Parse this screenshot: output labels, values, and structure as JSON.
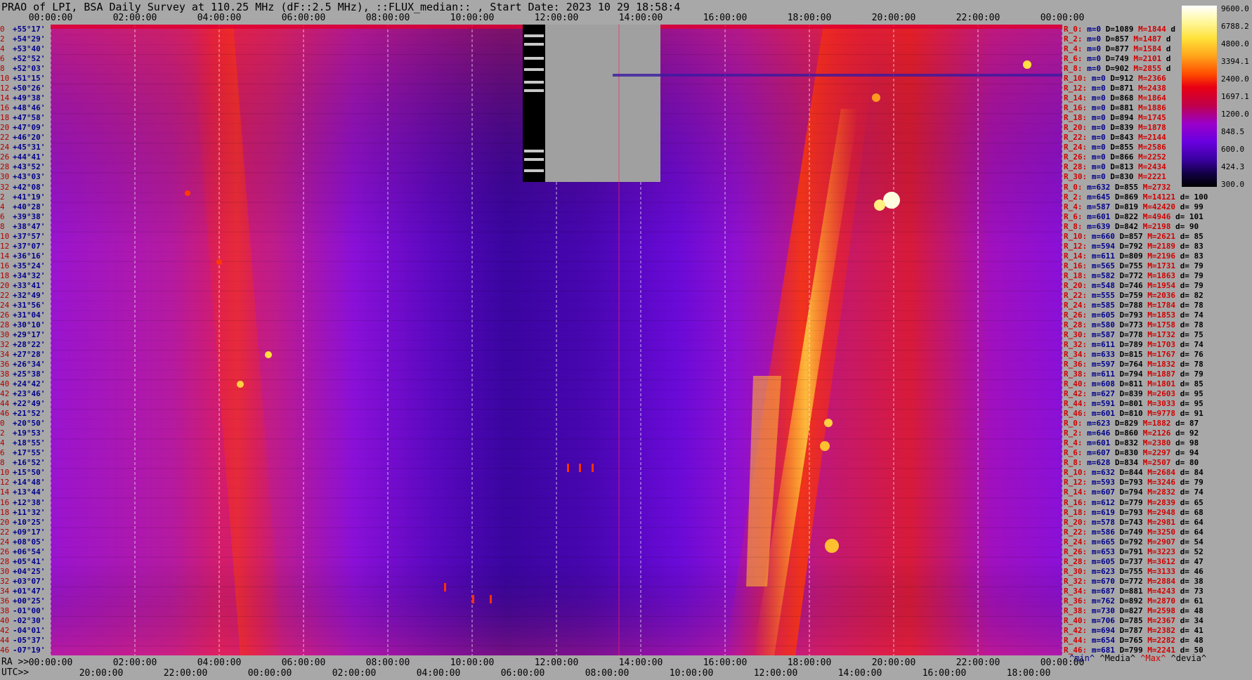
{
  "title": "PRAO of LPI, BSA Daily Survey at 110.25 MHz (dF::2.5 MHz), ::FLUX_median:: , Start Date: 2023 10 29 18:58:4",
  "top_axis_ticks": [
    "00:00:00",
    "02:00:00",
    "04:00:00",
    "06:00:00",
    "08:00:00",
    "10:00:00",
    "12:00:00",
    "14:00:00",
    "16:00:00",
    "18:00:00",
    "20:00:00",
    "22:00:00",
    "00:00:00"
  ],
  "bottom_axis_ra_prefix": "RA >>",
  "bottom_axis_ra_ticks": [
    "00:00:00",
    "02:00:00",
    "04:00:00",
    "06:00:00",
    "08:00:00",
    "10:00:00",
    "12:00:00",
    "14:00:00",
    "16:00:00",
    "18:00:00",
    "20:00:00",
    "22:00:00",
    "00:00:00"
  ],
  "bottom_axis_utc_prefix": "UTC>>",
  "bottom_axis_utc_ticks": [
    "20:00:00",
    "22:00:00",
    "00:00:00",
    "02:00:00",
    "04:00:00",
    "06:00:00",
    "08:00:00",
    "10:00:00",
    "12:00:00",
    "14:00:00",
    "16:00:00",
    "18:00:00"
  ],
  "colorbar": {
    "labels": [
      "9600.0",
      "6788.2",
      "4800.0",
      "3394.1",
      "2400.0",
      "1697.1",
      "1200.0",
      "848.5",
      "600.0",
      "424.3",
      "300.0"
    ]
  },
  "stats_footer": {
    "min": "^min^",
    "median": "^Media^",
    "max": "^Max^",
    "dev": "^devia^"
  },
  "chart_data": {
    "type": "heatmap",
    "title": "PRAO of LPI, BSA Daily Survey at 110.25 MHz (dF::2.5 MHz), ::FLUX_median:: , Start Date: 2023 10 29 18:58:4",
    "x_axis": "RA",
    "x_range_hours": [
      0,
      24
    ],
    "y_axis": "Declination",
    "dec_rows": [
      {
        "idx": "0",
        "dec": "+55°17'"
      },
      {
        "idx": "2",
        "dec": "+54°29'"
      },
      {
        "idx": "4",
        "dec": "+53°40'"
      },
      {
        "idx": "6",
        "dec": "+52°52'"
      },
      {
        "idx": "8",
        "dec": "+52°03'"
      },
      {
        "idx": "10",
        "dec": "+51°15'"
      },
      {
        "idx": "12",
        "dec": "+50°26'"
      },
      {
        "idx": "14",
        "dec": "+49°38'"
      },
      {
        "idx": "16",
        "dec": "+48°46'"
      },
      {
        "idx": "18",
        "dec": "+47°58'"
      },
      {
        "idx": "20",
        "dec": "+47°09'"
      },
      {
        "idx": "22",
        "dec": "+46°20'"
      },
      {
        "idx": "24",
        "dec": "+45°31'"
      },
      {
        "idx": "26",
        "dec": "+44°41'"
      },
      {
        "idx": "28",
        "dec": "+43°52'"
      },
      {
        "idx": "30",
        "dec": "+43°03'"
      },
      {
        "idx": "32",
        "dec": "+42°08'"
      },
      {
        "idx": "2",
        "dec": "+41°19'"
      },
      {
        "idx": "4",
        "dec": "+40°28'"
      },
      {
        "idx": "6",
        "dec": "+39°38'"
      },
      {
        "idx": "8",
        "dec": "+38°47'"
      },
      {
        "idx": "10",
        "dec": "+37°57'"
      },
      {
        "idx": "12",
        "dec": "+37°07'"
      },
      {
        "idx": "14",
        "dec": "+36°16'"
      },
      {
        "idx": "16",
        "dec": "+35°24'"
      },
      {
        "idx": "18",
        "dec": "+34°32'"
      },
      {
        "idx": "20",
        "dec": "+33°41'"
      },
      {
        "idx": "22",
        "dec": "+32°49'"
      },
      {
        "idx": "24",
        "dec": "+31°56'"
      },
      {
        "idx": "26",
        "dec": "+31°04'"
      },
      {
        "idx": "28",
        "dec": "+30°10'"
      },
      {
        "idx": "30",
        "dec": "+29°17'"
      },
      {
        "idx": "32",
        "dec": "+28°22'"
      },
      {
        "idx": "34",
        "dec": "+27°28'"
      },
      {
        "idx": "36",
        "dec": "+26°34'"
      },
      {
        "idx": "38",
        "dec": "+25°38'"
      },
      {
        "idx": "40",
        "dec": "+24°42'"
      },
      {
        "idx": "42",
        "dec": "+23°46'"
      },
      {
        "idx": "44",
        "dec": "+22°49'"
      },
      {
        "idx": "46",
        "dec": "+21°52'"
      },
      {
        "idx": "0",
        "dec": "+20°50'"
      },
      {
        "idx": "2",
        "dec": "+19°53'"
      },
      {
        "idx": "4",
        "dec": "+18°55'"
      },
      {
        "idx": "6",
        "dec": "+17°55'"
      },
      {
        "idx": "8",
        "dec": "+16°52'"
      },
      {
        "idx": "10",
        "dec": "+15°50'"
      },
      {
        "idx": "12",
        "dec": "+14°48'"
      },
      {
        "idx": "14",
        "dec": "+13°44'"
      },
      {
        "idx": "16",
        "dec": "+12°38'"
      },
      {
        "idx": "18",
        "dec": "+11°32'"
      },
      {
        "idx": "20",
        "dec": "+10°25'"
      },
      {
        "idx": "22",
        "dec": "+09°17'"
      },
      {
        "idx": "24",
        "dec": "+08°05'"
      },
      {
        "idx": "26",
        "dec": "+06°54'"
      },
      {
        "idx": "28",
        "dec": "+05°41'"
      },
      {
        "idx": "30",
        "dec": "+04°25'"
      },
      {
        "idx": "32",
        "dec": "+03°07'"
      },
      {
        "idx": "34",
        "dec": "+01°47'"
      },
      {
        "idx": "36",
        "dec": "+00°25'"
      },
      {
        "idx": "38",
        "dec": "-01°00'"
      },
      {
        "idx": "40",
        "dec": "-02°30'"
      },
      {
        "idx": "42",
        "dec": "-04°01'"
      },
      {
        "idx": "44",
        "dec": "-05°37'"
      },
      {
        "idx": "46",
        "dec": "-07°19'"
      }
    ],
    "row_stats": [
      {
        "r": "R_0:",
        "m": "m=0",
        "D": "D=1089",
        "M": "M=1844",
        "d": " d"
      },
      {
        "r": "R_2:",
        "m": "m=0",
        "D": "D=857",
        "M": "M=1487",
        "d": " d"
      },
      {
        "r": "R_4:",
        "m": "m=0",
        "D": "D=877",
        "M": "M=1584",
        "d": " d"
      },
      {
        "r": "R_6:",
        "m": "m=0",
        "D": "D=749",
        "M": "M=2101",
        "d": " d"
      },
      {
        "r": "R_8:",
        "m": "m=0",
        "D": "D=902",
        "M": "M=2855",
        "d": " d"
      },
      {
        "r": "R_10:",
        "m": "m=0",
        "D": "D=912",
        "M": "M=2366",
        "d": ""
      },
      {
        "r": "R_12:",
        "m": "m=0",
        "D": "D=871",
        "M": "M=2438",
        "d": ""
      },
      {
        "r": "R_14:",
        "m": "m=0",
        "D": "D=868",
        "M": "M=1864",
        "d": ""
      },
      {
        "r": "R_16:",
        "m": "m=0",
        "D": "D=881",
        "M": "M=1886",
        "d": ""
      },
      {
        "r": "R_18:",
        "m": "m=0",
        "D": "D=894",
        "M": "M=1745",
        "d": ""
      },
      {
        "r": "R_20:",
        "m": "m=0",
        "D": "D=839",
        "M": "M=1878",
        "d": ""
      },
      {
        "r": "R_22:",
        "m": "m=0",
        "D": "D=843",
        "M": "M=2144",
        "d": ""
      },
      {
        "r": "R_24:",
        "m": "m=0",
        "D": "D=855",
        "M": "M=2586",
        "d": ""
      },
      {
        "r": "R_26:",
        "m": "m=0",
        "D": "D=866",
        "M": "M=2252",
        "d": ""
      },
      {
        "r": "R_28:",
        "m": "m=0",
        "D": "D=813",
        "M": "M=2434",
        "d": ""
      },
      {
        "r": "R_30:",
        "m": "m=0",
        "D": "D=830",
        "M": "M=2221",
        "d": ""
      },
      {
        "r": "R_0:",
        "m": "m=632",
        "D": "D=855",
        "M": "M=2732",
        "d": ""
      },
      {
        "r": "R_2:",
        "m": "m=645",
        "D": "D=869",
        "M": "M=14121",
        "d": " d= 100"
      },
      {
        "r": "R_4:",
        "m": "m=587",
        "D": "D=819",
        "M": "M=42420",
        "d": " d= 99"
      },
      {
        "r": "R_6:",
        "m": "m=601",
        "D": "D=822",
        "M": "M=4946",
        "d": " d= 101"
      },
      {
        "r": "R_8:",
        "m": "m=639",
        "D": "D=842",
        "M": "M=2198",
        "d": " d= 90"
      },
      {
        "r": "R_10:",
        "m": "m=660",
        "D": "D=857",
        "M": "M=2621",
        "d": " d= 85"
      },
      {
        "r": "R_12:",
        "m": "m=594",
        "D": "D=792",
        "M": "M=2189",
        "d": " d= 83"
      },
      {
        "r": "R_14:",
        "m": "m=611",
        "D": "D=809",
        "M": "M=2196",
        "d": " d= 83"
      },
      {
        "r": "R_16:",
        "m": "m=565",
        "D": "D=755",
        "M": "M=1731",
        "d": " d= 79"
      },
      {
        "r": "R_18:",
        "m": "m=582",
        "D": "D=772",
        "M": "M=1863",
        "d": " d= 79"
      },
      {
        "r": "R_20:",
        "m": "m=548",
        "D": "D=746",
        "M": "M=1954",
        "d": " d= 79"
      },
      {
        "r": "R_22:",
        "m": "m=555",
        "D": "D=759",
        "M": "M=2036",
        "d": " d= 82"
      },
      {
        "r": "R_24:",
        "m": "m=585",
        "D": "D=788",
        "M": "M=1784",
        "d": " d= 78"
      },
      {
        "r": "R_26:",
        "m": "m=605",
        "D": "D=793",
        "M": "M=1853",
        "d": " d= 74"
      },
      {
        "r": "R_28:",
        "m": "m=580",
        "D": "D=773",
        "M": "M=1758",
        "d": " d= 78"
      },
      {
        "r": "R_30:",
        "m": "m=587",
        "D": "D=778",
        "M": "M=1732",
        "d": " d= 75"
      },
      {
        "r": "R_32:",
        "m": "m=611",
        "D": "D=789",
        "M": "M=1703",
        "d": " d= 74"
      },
      {
        "r": "R_34:",
        "m": "m=633",
        "D": "D=815",
        "M": "M=1767",
        "d": " d= 76"
      },
      {
        "r": "R_36:",
        "m": "m=597",
        "D": "D=764",
        "M": "M=1832",
        "d": " d= 78"
      },
      {
        "r": "R_38:",
        "m": "m=611",
        "D": "D=794",
        "M": "M=1887",
        "d": " d= 79"
      },
      {
        "r": "R_40:",
        "m": "m=608",
        "D": "D=811",
        "M": "M=1801",
        "d": " d= 85"
      },
      {
        "r": "R_42:",
        "m": "m=627",
        "D": "D=839",
        "M": "M=2603",
        "d": " d= 95"
      },
      {
        "r": "R_44:",
        "m": "m=591",
        "D": "D=801",
        "M": "M=3033",
        "d": " d= 95"
      },
      {
        "r": "R_46:",
        "m": "m=601",
        "D": "D=810",
        "M": "M=9778",
        "d": " d= 91"
      },
      {
        "r": "R_0:",
        "m": "m=623",
        "D": "D=829",
        "M": "M=1882",
        "d": " d= 87"
      },
      {
        "r": "R_2:",
        "m": "m=646",
        "D": "D=860",
        "M": "M=2126",
        "d": " d= 92"
      },
      {
        "r": "R_4:",
        "m": "m=601",
        "D": "D=832",
        "M": "M=2380",
        "d": " d= 98"
      },
      {
        "r": "R_6:",
        "m": "m=607",
        "D": "D=830",
        "M": "M=2297",
        "d": " d= 94"
      },
      {
        "r": "R_8:",
        "m": "m=628",
        "D": "D=834",
        "M": "M=2507",
        "d": " d= 80"
      },
      {
        "r": "R_10:",
        "m": "m=632",
        "D": "D=844",
        "M": "M=2684",
        "d": " d= 84"
      },
      {
        "r": "R_12:",
        "m": "m=593",
        "D": "D=793",
        "M": "M=3246",
        "d": " d= 79"
      },
      {
        "r": "R_14:",
        "m": "m=607",
        "D": "D=794",
        "M": "M=2832",
        "d": " d= 74"
      },
      {
        "r": "R_16:",
        "m": "m=612",
        "D": "D=779",
        "M": "M=2839",
        "d": " d= 65"
      },
      {
        "r": "R_18:",
        "m": "m=619",
        "D": "D=793",
        "M": "M=2948",
        "d": " d= 68"
      },
      {
        "r": "R_20:",
        "m": "m=578",
        "D": "D=743",
        "M": "M=2981",
        "d": " d= 64"
      },
      {
        "r": "R_22:",
        "m": "m=586",
        "D": "D=749",
        "M": "M=3250",
        "d": " d= 64"
      },
      {
        "r": "R_24:",
        "m": "m=665",
        "D": "D=792",
        "M": "M=2907",
        "d": " d= 54"
      },
      {
        "r": "R_26:",
        "m": "m=653",
        "D": "D=791",
        "M": "M=3223",
        "d": " d= 52"
      },
      {
        "r": "R_28:",
        "m": "m=605",
        "D": "D=737",
        "M": "M=3612",
        "d": " d= 47"
      },
      {
        "r": "R_30:",
        "m": "m=623",
        "D": "D=755",
        "M": "M=3133",
        "d": " d= 46"
      },
      {
        "r": "R_32:",
        "m": "m=670",
        "D": "D=772",
        "M": "M=2884",
        "d": " d= 38"
      },
      {
        "r": "R_34:",
        "m": "m=687",
        "D": "D=881",
        "M": "M=4243",
        "d": " d= 73"
      },
      {
        "r": "R_36:",
        "m": "m=762",
        "D": "D=892",
        "M": "M=2870",
        "d": " d= 61"
      },
      {
        "r": "R_38:",
        "m": "m=730",
        "D": "D=827",
        "M": "M=2598",
        "d": " d= 48"
      },
      {
        "r": "R_40:",
        "m": "m=706",
        "D": "D=785",
        "M": "M=2367",
        "d": " d= 34"
      },
      {
        "r": "R_42:",
        "m": "m=694",
        "D": "D=787",
        "M": "M=2382",
        "d": " d= 41"
      },
      {
        "r": "R_44:",
        "m": "m=654",
        "D": "D=765",
        "M": "M=2282",
        "d": " d= 48"
      },
      {
        "r": "R_46:",
        "m": "m=681",
        "D": "D=799",
        "M": "M=2241",
        "d": " d= 50"
      }
    ],
    "colorbar_range": [
      300.0,
      9600.0
    ],
    "colorbar_scale": "log",
    "grid": true
  }
}
